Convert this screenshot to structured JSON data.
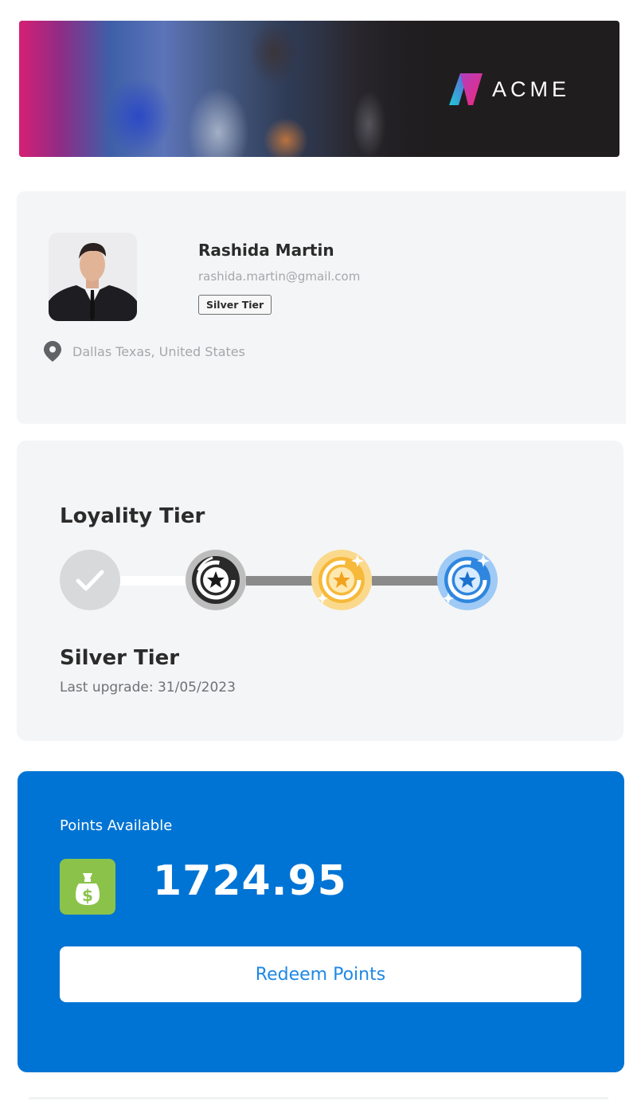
{
  "banner": {
    "brand_name": "ACME",
    "colors": {
      "background": "#201d1f",
      "logo_left": "#1ec8d6",
      "logo_right": "#e8297a"
    }
  },
  "profile": {
    "name": "Rashida Martin",
    "email": "rashida.martin@gmail.com",
    "tier_badge": "Silver Tier",
    "location": "Dallas Texas, United States",
    "location_icon": "map-pin-icon"
  },
  "loyalty": {
    "title": "Loyality Tier",
    "tiers": [
      {
        "icon": "check-icon",
        "status": "completed"
      },
      {
        "icon": "silver-star-medal-icon",
        "status": "current"
      },
      {
        "icon": "gold-star-medal-icon",
        "status": "locked"
      },
      {
        "icon": "platinum-star-medal-icon",
        "status": "locked"
      }
    ],
    "current_tier": "Silver Tier",
    "last_upgrade": "Last upgrade: 31/05/2023"
  },
  "points": {
    "label": "Points Available",
    "icon": "money-bag-icon",
    "value": "1724.95",
    "redeem_label": "Redeem Points",
    "colors": {
      "card": "#0074d4",
      "icon_bg": "#8bc34a",
      "button_text": "#1e88e5"
    }
  }
}
